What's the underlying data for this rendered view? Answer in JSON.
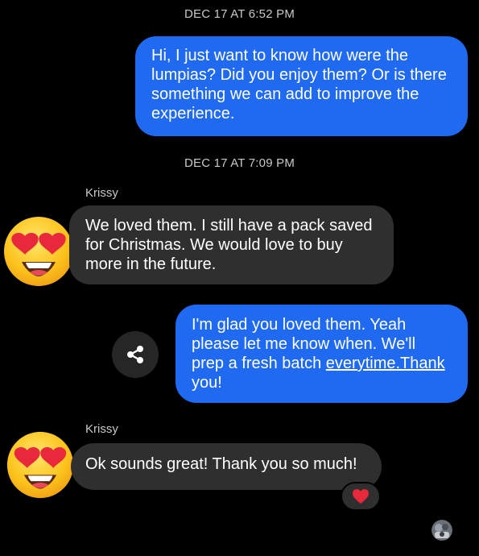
{
  "conversation": {
    "timestamps": [
      "DEC 17 AT 6:52 PM",
      "DEC 17 AT 7:09 PM"
    ],
    "messages": [
      {
        "direction": "outgoing",
        "text": "Hi, I just want to know how were the lumpias? Did you enjoy them? Or is there something we can add to improve the experience."
      },
      {
        "direction": "incoming",
        "sender": "Krissy",
        "text": "We loved them. I still have a pack saved for Christmas.  We would love to buy more in the future."
      },
      {
        "direction": "outgoing",
        "text_before_link": "I'm glad you loved them. Yeah please let me know when. We'll prep a fresh batch ",
        "link_text": "everytime.Thank",
        "text_after_link": " you!"
      },
      {
        "direction": "incoming",
        "sender": "Krissy",
        "text": "Ok sounds great! Thank you so much!",
        "reaction": "heart"
      }
    ]
  },
  "icons": {
    "avatar": "heart-eyes-emoji-icon",
    "share": "share-icon",
    "reaction": "heart-icon",
    "seen": "seen-avatar-icon"
  },
  "colors": {
    "background": "#000000",
    "outgoing_bubble": "#1f6af0",
    "incoming_bubble": "#2f2f2f",
    "timestamp_text": "#c8c8c8",
    "reaction_heart": "#e8283b"
  }
}
